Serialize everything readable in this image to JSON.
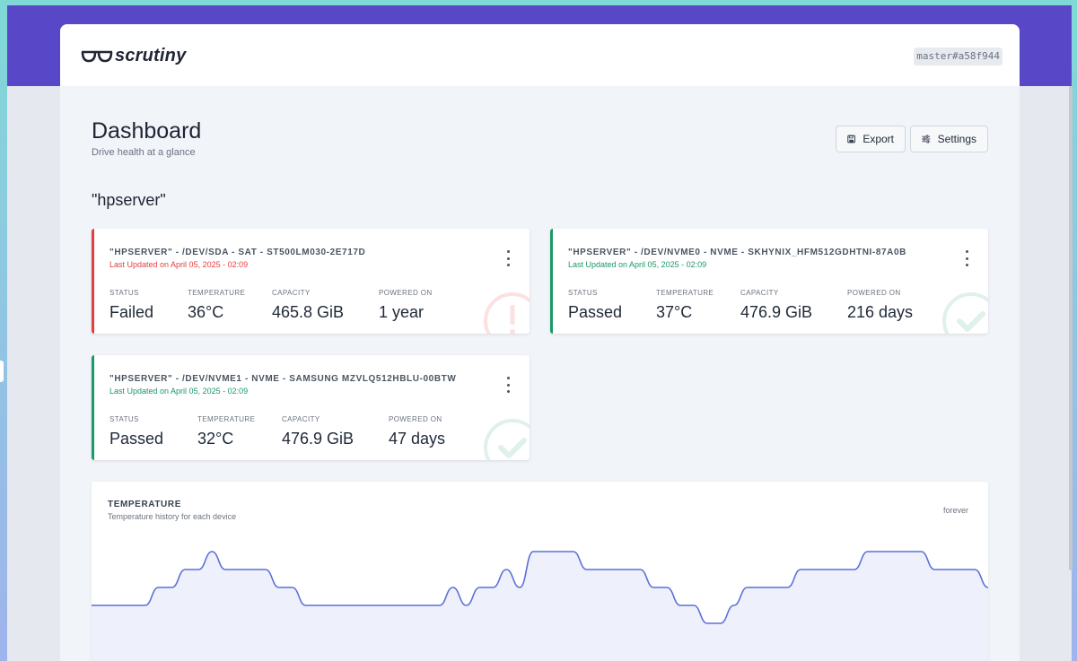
{
  "topbar": {
    "brand": "scrutiny",
    "version": "master#a58f944"
  },
  "page": {
    "title": "Dashboard",
    "subtitle": "Drive health at a glance"
  },
  "toolbar": {
    "export_label": "Export",
    "settings_label": "Settings"
  },
  "group": {
    "title": "\"hpserver\""
  },
  "stat_labels": {
    "status": "Status",
    "temperature": "Temperature",
    "capacity": "Capacity",
    "powered_on": "Powered On"
  },
  "devices": [
    {
      "title": "\"HPSERVER\" - /DEV/SDA - SAT - ST500LM030-2E717D",
      "updated": "Last Updated on April 05, 2025 - 02:09",
      "status": "Failed",
      "temperature": "36°C",
      "capacity": "465.8 GiB",
      "powered_on": "1 year",
      "state": "failed",
      "accent_color": "#e53e3e",
      "watermark_icon": "exclamation-circle-icon"
    },
    {
      "title": "\"HPSERVER\" - /DEV/NVME0 - NVME - SKHYNIX_HFM512GDHTNI-87A0B",
      "updated": "Last Updated on April 05, 2025 - 02:09",
      "status": "Passed",
      "temperature": "37°C",
      "capacity": "476.9 GiB",
      "powered_on": "216 days",
      "state": "passed",
      "accent_color": "#1a9966",
      "watermark_icon": "check-circle-icon"
    },
    {
      "title": "\"HPSERVER\" - /DEV/NVME1 - NVME - SAMSUNG MZVLQ512HBLU-00BTW",
      "updated": "Last Updated on April 05, 2025 - 02:09",
      "status": "Passed",
      "temperature": "32°C",
      "capacity": "476.9 GiB",
      "powered_on": "47 days",
      "state": "passed",
      "accent_color": "#1a9966",
      "watermark_icon": "check-circle-icon"
    }
  ],
  "temperature_chart": {
    "title": "TEMPERATURE",
    "subtitle": "Temperature history for each device",
    "range": "forever",
    "line_color": "#5b6fd6",
    "fill_color": "#eef0fc"
  },
  "chart_data": {
    "type": "area",
    "title": "TEMPERATURE",
    "subtitle": "Temperature history for each device",
    "grid": false,
    "legend": "none",
    "series": [
      {
        "values": [
          32,
          32,
          32,
          32,
          32,
          34,
          34,
          36,
          36,
          38,
          36,
          36,
          36,
          36,
          34,
          34,
          32,
          32,
          32,
          32,
          32,
          32,
          32,
          32,
          32,
          32,
          32,
          34,
          32,
          34,
          34,
          36,
          34,
          38,
          38,
          38,
          38,
          36,
          36,
          36,
          36,
          36,
          34,
          34,
          32,
          32,
          30,
          30,
          32,
          34,
          34,
          34,
          34,
          36,
          36,
          36,
          36,
          36,
          38,
          38,
          38,
          38,
          38,
          36,
          36,
          36,
          36,
          34
        ]
      }
    ]
  }
}
